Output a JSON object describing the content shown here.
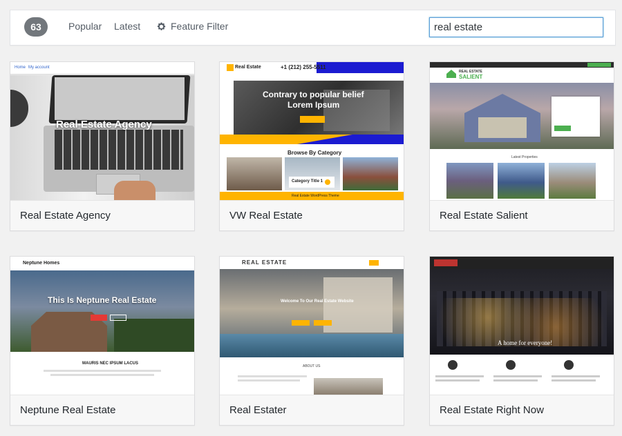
{
  "filter_bar": {
    "count": "63",
    "links": {
      "popular": "Popular",
      "latest": "Latest",
      "feature_filter": "Feature Filter"
    },
    "search": {
      "value": "real estate"
    }
  },
  "themes": [
    {
      "name": "Real Estate Agency",
      "preview": {
        "nav_home": "Home",
        "nav_account": "My account",
        "hero_title": "Real Estate Agency"
      }
    },
    {
      "name": "VW Real Estate",
      "preview": {
        "logo": "Real Estate",
        "phone": "+1 (212) 255-5511",
        "hero_line1": "Contrary to popular belief",
        "hero_line2": "Lorem Ipsum",
        "section_title": "Browse By Category",
        "category_label": "Category Title 1",
        "footer": "Real Estate WordPress Theme"
      }
    },
    {
      "name": "Real Estate Salient",
      "preview": {
        "logo_line1": "REAL ESTATE",
        "logo_line2": "SALIENT",
        "listing_caption": "Latest Properties"
      }
    },
    {
      "name": "Neptune Real Estate",
      "preview": {
        "logo": "Neptune Homes",
        "hero_title": "This Is Neptune Real Estate",
        "section_title": "MAURIS NEC IPSUM LACUS"
      }
    },
    {
      "name": "Real Estater",
      "preview": {
        "logo": "REAL ESTATE",
        "hero_title": "Welcome To Our Real Estate Website",
        "section_title": "ABOUT US"
      }
    },
    {
      "name": "Real Estate Right Now",
      "preview": {
        "hero_tagline": "A home for everyone!"
      }
    }
  ],
  "colors": {
    "accent_blue": "#5b9dd9",
    "count_badge": "#72777c",
    "vw_yellow": "#ffb400",
    "vw_blue": "#1b1bd1",
    "salient_green": "#4caf50",
    "neptune_red": "#e53935"
  }
}
